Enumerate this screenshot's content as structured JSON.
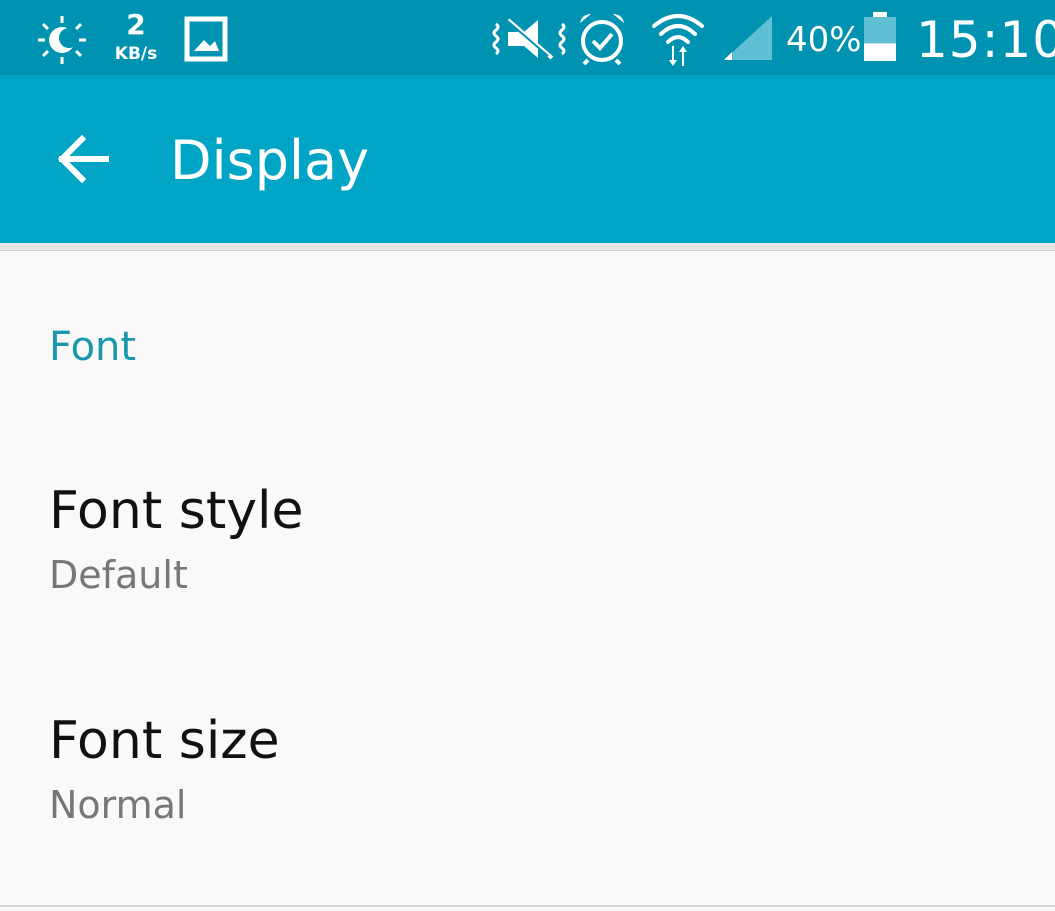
{
  "status_bar": {
    "data_speed_value": "2",
    "data_speed_unit": "KB/s",
    "battery_percent": "40%",
    "battery_level": 0.4,
    "time": "15:10",
    "icons": [
      "brightness-icon",
      "gallery-icon",
      "vibrate-off-icon",
      "alarm-icon",
      "wifi-icon",
      "signal-icon",
      "battery-icon"
    ]
  },
  "app_bar": {
    "back_icon": "arrow-left-icon",
    "title": "Display"
  },
  "content": {
    "section_header": "Font",
    "items": [
      {
        "title": "Font style",
        "summary": "Default"
      },
      {
        "title": "Font size",
        "summary": "Normal"
      }
    ]
  },
  "colors": {
    "status_bar": "#0093b1",
    "app_bar": "#00a5c5",
    "accent": "#1a97ad",
    "background": "#f9f9f9",
    "primary_text": "#111111",
    "secondary_text": "#777777"
  }
}
